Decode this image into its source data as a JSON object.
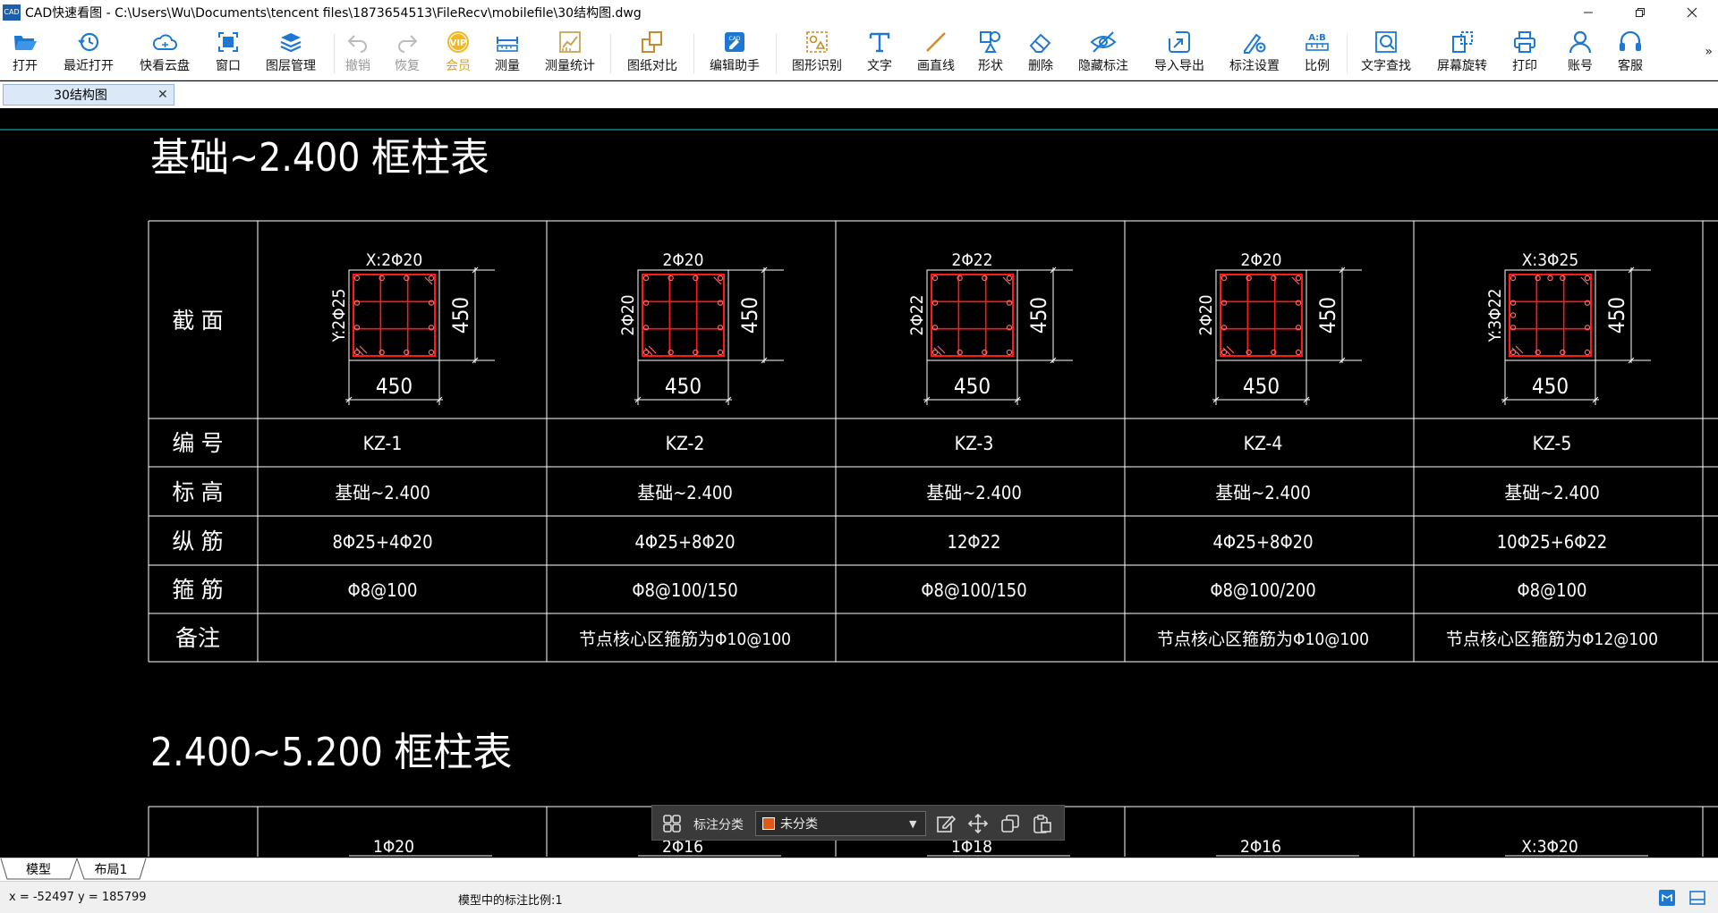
{
  "window": {
    "app_icon": "CAD",
    "title": "CAD快速看图 - C:\\Users\\Wu\\Documents\\tencent files\\1873654513\\FileRecv\\mobilefile\\30结构图.dwg",
    "minimize_icon": "minimize-icon",
    "restore_icon": "restore-icon",
    "close_icon": "close-icon"
  },
  "toolbar": {
    "open": "打开",
    "recent": "最近打开",
    "cloud": "快看云盘",
    "window": "窗口",
    "layers": "图层管理",
    "undo": "撤销",
    "redo": "恢复",
    "vip": "会员",
    "measure": "测量",
    "measure_stats": "测量统计",
    "compare": "图纸对比",
    "edit_assistant": "编辑助手",
    "shape_recognize": "图形识别",
    "text": "文字",
    "line": "画直线",
    "shape": "形状",
    "delete": "删除",
    "hide_annotation": "隐藏标注",
    "import_export": "导入导出",
    "annotation_settings": "标注设置",
    "scale": "比例",
    "text_search": "文字查找",
    "rotate_screen": "屏幕旋转",
    "print": "打印",
    "account": "账号",
    "service": "客服",
    "more": "»",
    "colors": {
      "accent": "#1e78d2",
      "vip": "#d9a21b",
      "disabled": "#999999"
    }
  },
  "tabs": {
    "doc_tab": "30结构图",
    "close": "✕"
  },
  "drawing": {
    "table1": {
      "title": "基础~2.400  框柱表",
      "row_headers": [
        "截 面",
        "编 号",
        "标 高",
        "纵 筋",
        "箍 筋",
        "备注"
      ],
      "columns": [
        {
          "top_label": "X:2Φ20",
          "side_label": "Y:2Φ25",
          "dim_bottom": "450",
          "dim_right": "450",
          "id": "KZ-1",
          "elevation": "基础~2.400",
          "long_bars": "8Φ25+4Φ20",
          "stirrups": "Φ8@100",
          "note": ""
        },
        {
          "top_label": "2Φ20",
          "side_label": "2Φ20",
          "dim_bottom": "450",
          "dim_right": "450",
          "id": "KZ-2",
          "elevation": "基础~2.400",
          "long_bars": "4Φ25+8Φ20",
          "stirrups": "Φ8@100/150",
          "note": "节点核心区箍筋为Φ10@100"
        },
        {
          "top_label": "2Φ22",
          "side_label": "2Φ22",
          "dim_bottom": "450",
          "dim_right": "450",
          "id": "KZ-3",
          "elevation": "基础~2.400",
          "long_bars": "12Φ22",
          "stirrups": "Φ8@100/150",
          "note": ""
        },
        {
          "top_label": "2Φ20",
          "side_label": "2Φ20",
          "dim_bottom": "450",
          "dim_right": "450",
          "id": "KZ-4",
          "elevation": "基础~2.400",
          "long_bars": "4Φ25+8Φ20",
          "stirrups": "Φ8@100/200",
          "note": "节点核心区箍筋为Φ10@100"
        },
        {
          "top_label": "X:3Φ25",
          "side_label": "Y:3Φ22",
          "dim_bottom": "450",
          "dim_right": "450",
          "id": "KZ-5",
          "elevation": "基础~2.400",
          "long_bars": "10Φ25+6Φ22",
          "stirrups": "Φ8@100",
          "note": "节点核心区箍筋为Φ12@100"
        }
      ]
    },
    "table2": {
      "title": "2.400~5.200  框柱表",
      "top_labels": [
        "1Φ20",
        "2Φ16",
        "1Φ18",
        "2Φ16",
        "X:3Φ20"
      ]
    },
    "colors": {
      "line": "#ffffff",
      "section": "#ff1a1a",
      "rebar": "#ff6666",
      "cyan_line": "#1ec8c8"
    }
  },
  "floatbar": {
    "grid_icon": "grid-icon",
    "label": "标注分类",
    "select_value": "未分类",
    "swatch_color": "#e25616",
    "caret": "▼",
    "icons": [
      "edit-icon",
      "move-icon",
      "copy-icon",
      "paste-icon"
    ]
  },
  "layout_tabs": {
    "model": "模型",
    "layout1": "布局1"
  },
  "status": {
    "coords": "x = -52497 y = 185799",
    "scale_text": "模型中的标注比例:1"
  }
}
